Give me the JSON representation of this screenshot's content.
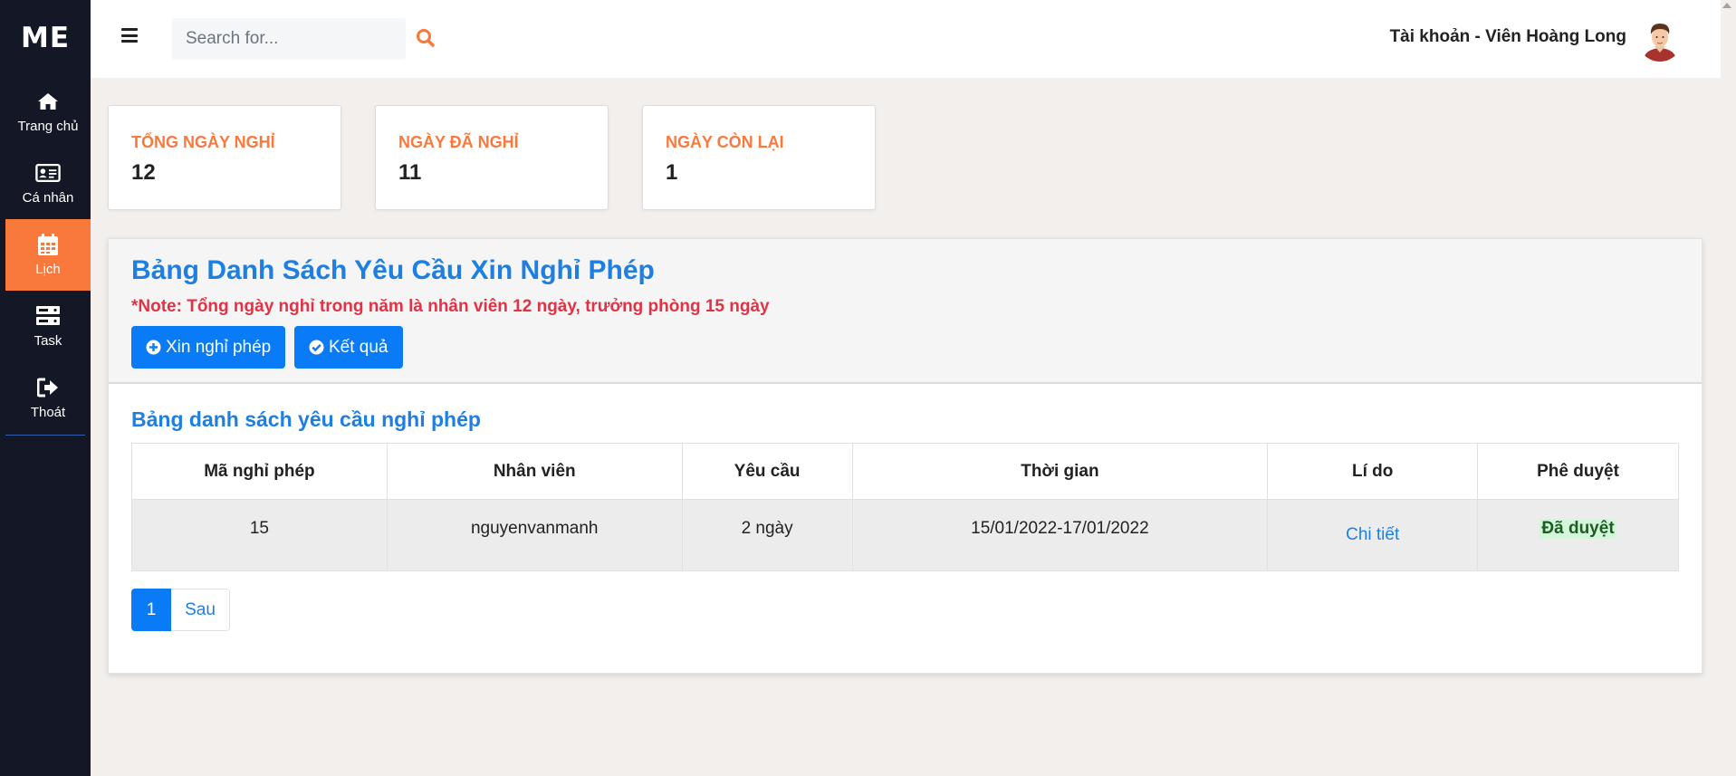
{
  "brand": "ME",
  "sidebar": {
    "items": [
      {
        "label": "Trang chủ",
        "icon": "home-icon"
      },
      {
        "label": "Cá nhân",
        "icon": "id-card-icon"
      },
      {
        "label": "Lịch",
        "icon": "calendar-icon",
        "active": true
      },
      {
        "label": "Task",
        "icon": "server-icon"
      },
      {
        "label": "Thoát",
        "icon": "sign-out-icon"
      }
    ]
  },
  "topbar": {
    "search_placeholder": "Search for...",
    "account": "Tài khoản - Viên Hoàng Long"
  },
  "stats": [
    {
      "label": "TỔNG NGÀY NGHỈ",
      "value": "12"
    },
    {
      "label": "NGÀY ĐÃ NGHỈ",
      "value": "11"
    },
    {
      "label": "NGÀY CÒN LẠI",
      "value": "1"
    }
  ],
  "panel": {
    "title": "Bảng Danh Sách Yêu Cầu Xin Nghỉ Phép",
    "note": "*Note: Tổng ngày nghỉ trong năm là nhân viên 12 ngày, trưởng phòng 15 ngày",
    "btn_request": "Xin nghỉ phép",
    "btn_result": "Kết quả",
    "subtitle": "Bảng danh sách yêu cầu nghỉ phép"
  },
  "table": {
    "headers": [
      "Mã nghỉ phép",
      "Nhân viên",
      "Yêu cầu",
      "Thời gian",
      "Lí do",
      "Phê duyệt"
    ],
    "rows": [
      {
        "id": "15",
        "employee": "nguyenvanmanh",
        "request": "2 ngày",
        "time": "15/01/2022-17/01/2022",
        "reason": "Chi tiết",
        "status": "Đã duyệt"
      }
    ]
  },
  "pagination": {
    "current": "1",
    "next": "Sau"
  },
  "colors": {
    "accent": "#f9793d",
    "primary": "#0a7bf7",
    "sidebar": "#141726",
    "title": "#1e7fe0",
    "note": "#e03345"
  }
}
